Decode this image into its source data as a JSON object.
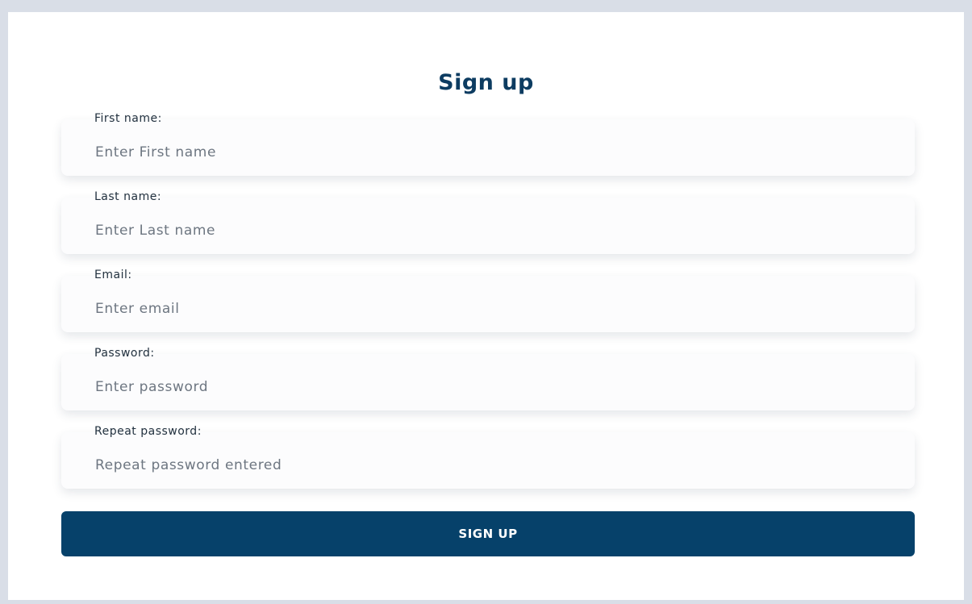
{
  "form": {
    "title": "Sign up",
    "fields": [
      {
        "label": "First name:",
        "placeholder": "Enter First name",
        "value": ""
      },
      {
        "label": "Last name:",
        "placeholder": "Enter Last name",
        "value": ""
      },
      {
        "label": "Email:",
        "placeholder": "Enter email",
        "value": ""
      },
      {
        "label": "Password:",
        "placeholder": "Enter password",
        "value": ""
      },
      {
        "label": "Repeat password:",
        "placeholder": "Repeat password entered",
        "value": ""
      }
    ],
    "submit_label": "SIGN UP"
  },
  "colors": {
    "page_background": "#d9dee7",
    "card_background": "#ffffff",
    "title": "#0d3c61",
    "button": "#06416a",
    "button_text": "#ffffff"
  }
}
